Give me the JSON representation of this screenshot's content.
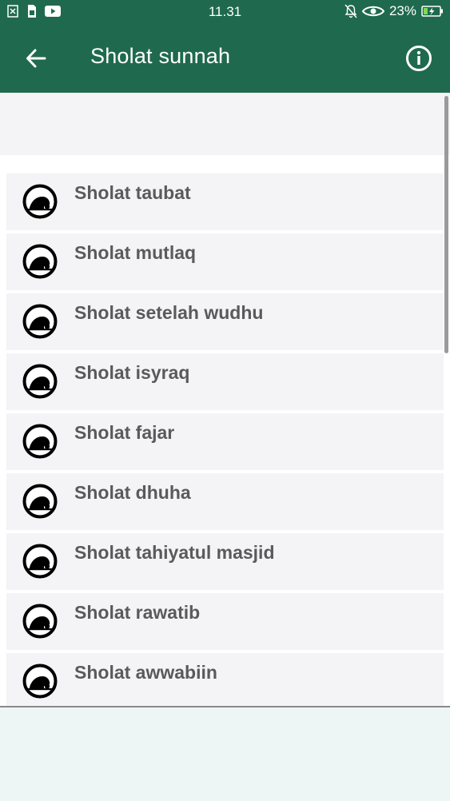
{
  "status_bar": {
    "time": "11.31",
    "battery": "23%",
    "icons_left": [
      "close-box-icon",
      "sim-card-icon",
      "youtube-icon"
    ],
    "icons_right": [
      "bell-off-icon",
      "eye-icon",
      "battery-charging-icon"
    ]
  },
  "app_bar": {
    "title": "Sholat sunnah",
    "back_icon": "arrow-left-icon",
    "info_icon": "info-circle-icon"
  },
  "list": {
    "items": [
      {
        "label": "Sholat taubat"
      },
      {
        "label": "Sholat mutlaq"
      },
      {
        "label": "Sholat setelah wudhu"
      },
      {
        "label": "Sholat isyraq"
      },
      {
        "label": "Sholat fajar"
      },
      {
        "label": "Sholat dhuha"
      },
      {
        "label": "Sholat tahiyatul masjid"
      },
      {
        "label": "Sholat rawatib"
      },
      {
        "label": "Sholat awwabiin"
      }
    ],
    "item_icon": "prostrating-person-icon"
  },
  "colors": {
    "primary": "#1f6a4e",
    "item_background": "#f4f4f6",
    "item_text": "#5a5a5a"
  }
}
